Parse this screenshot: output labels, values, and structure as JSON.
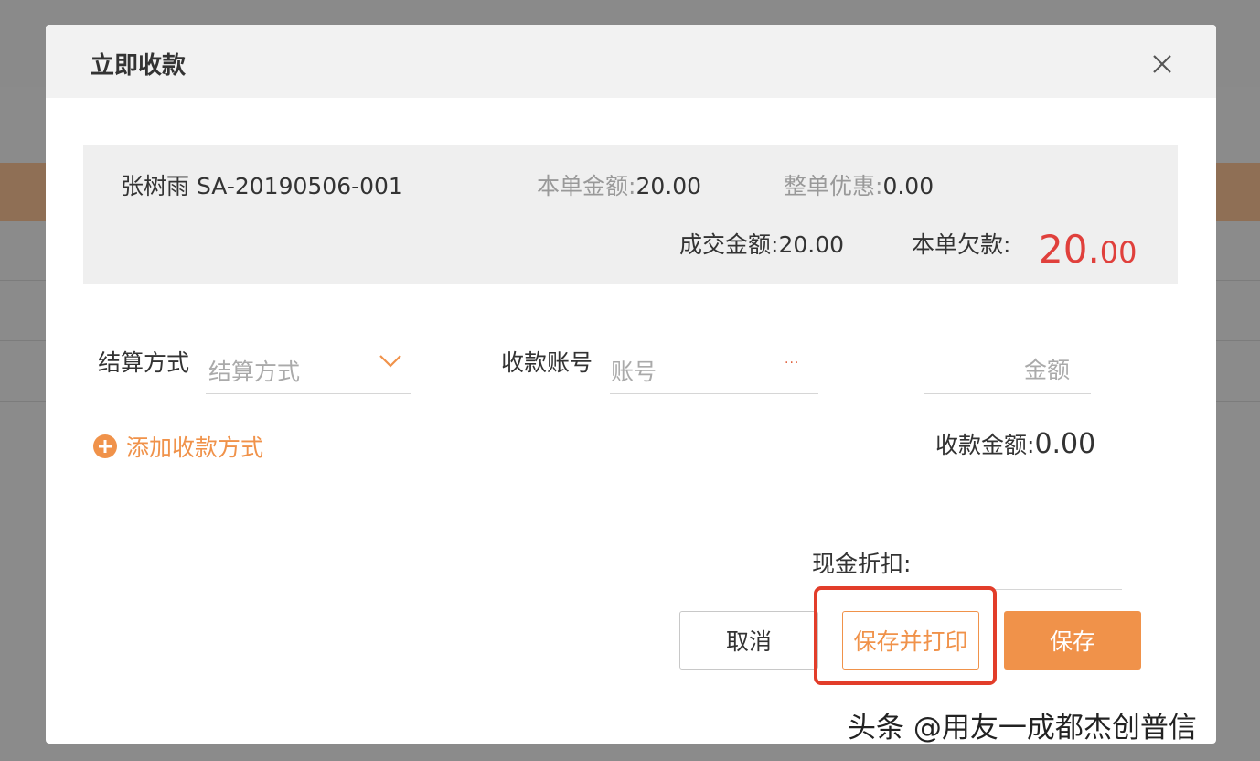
{
  "modal": {
    "title": "立即收款"
  },
  "summary": {
    "customer_order": "张树雨 SA-20190506-001",
    "order_amount_label": "本单金额:",
    "order_amount": "20.00",
    "discount_label": "整单优惠:",
    "discount": "0.00",
    "deal_amount_label": "成交金额:",
    "deal_amount": "20.00",
    "debt_label": "本单欠款:",
    "debt_int": "20.",
    "debt_dec": "00"
  },
  "form": {
    "settlement_label": "结算方式",
    "settlement_placeholder": "结算方式",
    "account_label": "收款账号",
    "account_placeholder": "账号",
    "account_more": "···",
    "amount_placeholder": "金额",
    "add_method_label": "添加收款方式",
    "received_label": "收款金额:",
    "received_value": "0.00",
    "cash_discount_label": "现金折扣:"
  },
  "buttons": {
    "cancel": "取消",
    "save_print": "保存并打印",
    "save": "保存"
  },
  "watermark": "头条 @用友一成都杰创普信",
  "colors": {
    "accent": "#f0924a",
    "debt": "#e0403c",
    "highlight": "#e23d2a"
  }
}
